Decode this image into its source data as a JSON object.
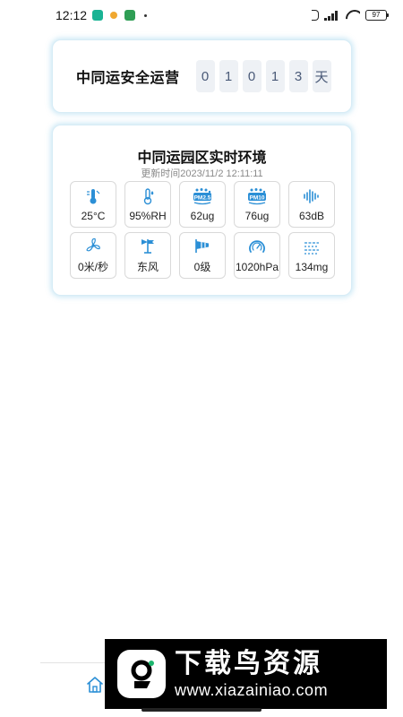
{
  "status_bar": {
    "time": "12:12",
    "battery": "97"
  },
  "safe_operation": {
    "title": "中同运安全运营",
    "digits": [
      "0",
      "1",
      "0",
      "1",
      "3"
    ],
    "unit": "天"
  },
  "environment": {
    "title": "中同运园区实时环境",
    "update_time": "更新时间2023/11/2 12:11:11",
    "tiles": [
      {
        "icon": "temperature-icon",
        "value": "25°C"
      },
      {
        "icon": "humidity-icon",
        "value": "95%RH"
      },
      {
        "icon": "pm25-icon",
        "icon_label": "PM2.5",
        "value": "62ug"
      },
      {
        "icon": "pm10-icon",
        "icon_label": "PM10",
        "value": "76ug"
      },
      {
        "icon": "noise-icon",
        "value": "63dB"
      },
      {
        "icon": "wind-speed-icon",
        "value": "0米/秒"
      },
      {
        "icon": "wind-direction-icon",
        "value": "东风"
      },
      {
        "icon": "wind-level-icon",
        "value": "0级"
      },
      {
        "icon": "pressure-icon",
        "value": "1020hPa"
      },
      {
        "icon": "dust-icon",
        "value": "134mg"
      }
    ]
  },
  "watermark": {
    "brand": "下载鸟资源",
    "url": "www.xiazainiao.com"
  },
  "colors": {
    "accent_blue": "#2b8fd6",
    "card_border": "#d7ecf6",
    "digit_bg": "#eef1f5"
  }
}
